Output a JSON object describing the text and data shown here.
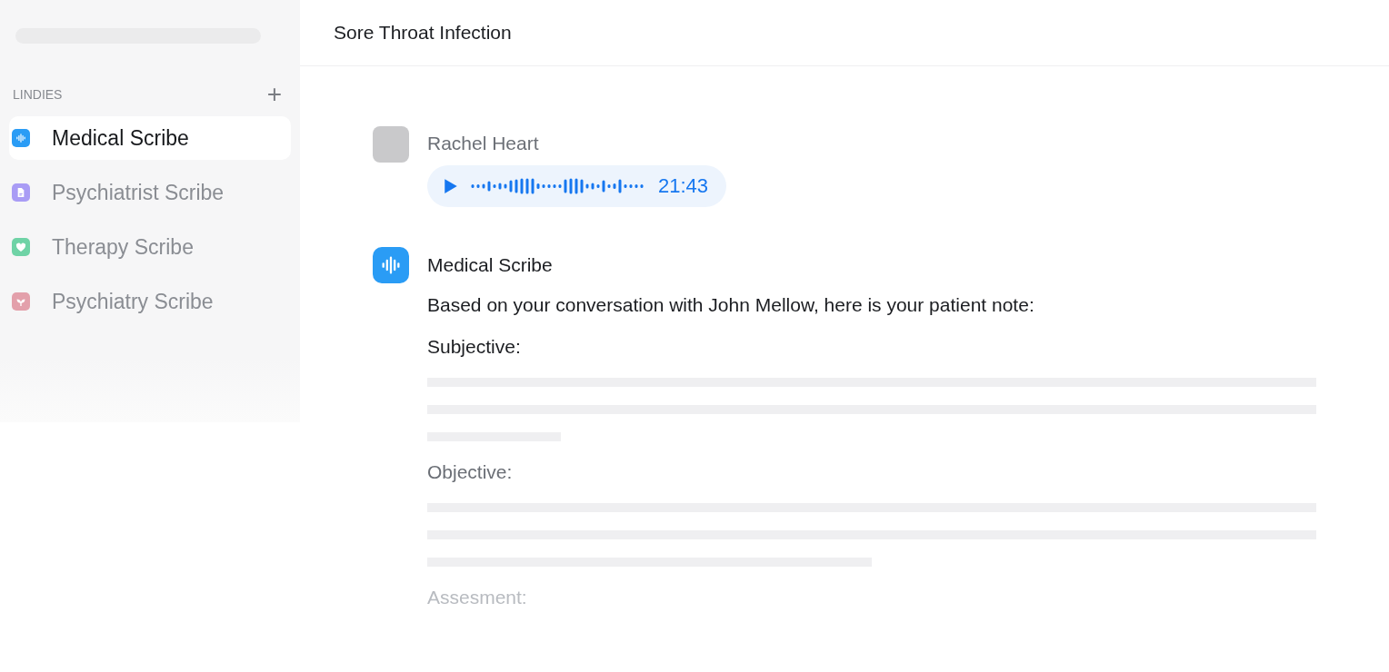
{
  "sidebar": {
    "section_label": "LINDIES",
    "add_button": "+",
    "items": [
      {
        "label": "Medical Scribe",
        "selected": true,
        "kind": "wave",
        "color": "#2a9cf5"
      },
      {
        "label": "Psychiatrist Scribe",
        "selected": false,
        "kind": "document",
        "color": "#a99cf5"
      },
      {
        "label": "Therapy Scribe",
        "selected": false,
        "kind": "heart",
        "color": "#6fd3a6"
      },
      {
        "label": "Psychiatry Scribe",
        "selected": false,
        "kind": "sprout",
        "color": "#e3a0ab"
      }
    ]
  },
  "header": {
    "title": "Sore Throat Infection"
  },
  "messages": [
    {
      "kind": "voice",
      "author": "Rachel Heart",
      "duration": "21:43"
    },
    {
      "kind": "note",
      "author": "Medical Scribe",
      "intro": "Based on your conversation with John Mellow, here is your patient note:",
      "sections": [
        {
          "heading": "Subjective:"
        },
        {
          "heading": "Objective:"
        },
        {
          "heading": "Assesment:"
        }
      ]
    }
  ]
}
